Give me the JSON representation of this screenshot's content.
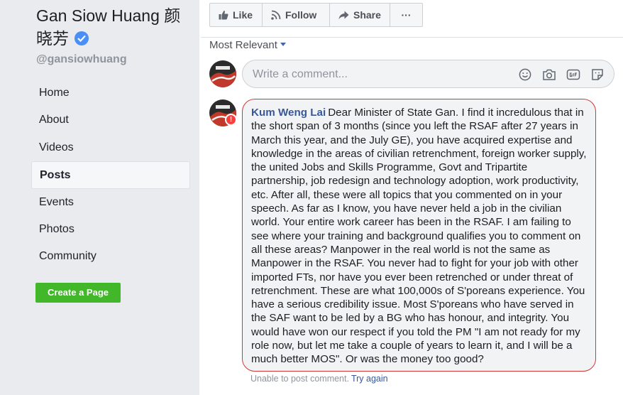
{
  "page": {
    "name": "Gan Siow Huang 颜晓芳",
    "handle": "@gansiowhuang",
    "verified_icon": "verified-badge-icon"
  },
  "nav": {
    "items": [
      {
        "label": "Home",
        "active": false
      },
      {
        "label": "About",
        "active": false
      },
      {
        "label": "Videos",
        "active": false
      },
      {
        "label": "Posts",
        "active": true
      },
      {
        "label": "Events",
        "active": false
      },
      {
        "label": "Photos",
        "active": false
      },
      {
        "label": "Community",
        "active": false
      }
    ],
    "create_page_label": "Create a Page"
  },
  "actions": {
    "like": "Like",
    "follow": "Follow",
    "share": "Share",
    "more": "···"
  },
  "comments": {
    "sort_label": "Most Relevant",
    "composer_placeholder": "Write a comment...",
    "composer_tools": [
      "emoji-icon",
      "camera-icon",
      "gif-icon",
      "sticker-icon"
    ],
    "comment": {
      "author": "Kum Weng Lai",
      "text": "Dear Minister of State Gan. I find it incredulous that in the short span of 3 months (since you left the RSAF after 27 years in March this year, and the July GE), you have acquired expertise and knowledge in the areas of civilian retrenchment, foreign worker supply, the united Jobs and Skills Programme, Govt and Tripartite partnership, job redesign and technology adoption, work productivity, etc. After all, these were all topics that you commented on in your speech. As far as I know, you have never held a job in the civilian world. Your entire work career has been in the RSAF. I am failing to see where your training and background qualifies you to comment on all these areas? Manpower in the real world is not the same as Manpower in the RSAF. You never had to fight for your job with other imported FTs, nor have you ever been retrenched or under threat of retrenchment. These are what 100,000s of S'poreans experience. You have a serious credibility issue. Most S'poreans who have served in the SAF want to be led by a BG who has honour, and integrity. You would have won our respect if you told the PM \"I am not ready for my role now, but let me take a couple of years to learn it, and I will be a much better MOS\". Or was the money too good?",
      "alert_mark": "!"
    },
    "error_text": "Unable to post comment.",
    "retry_label": "Try again"
  },
  "colors": {
    "sidebar_bg": "#e9ebee",
    "link_blue": "#385898",
    "create_green": "#42b72a",
    "error_red": "#d03737",
    "verified_blue": "#4a8ff5"
  }
}
